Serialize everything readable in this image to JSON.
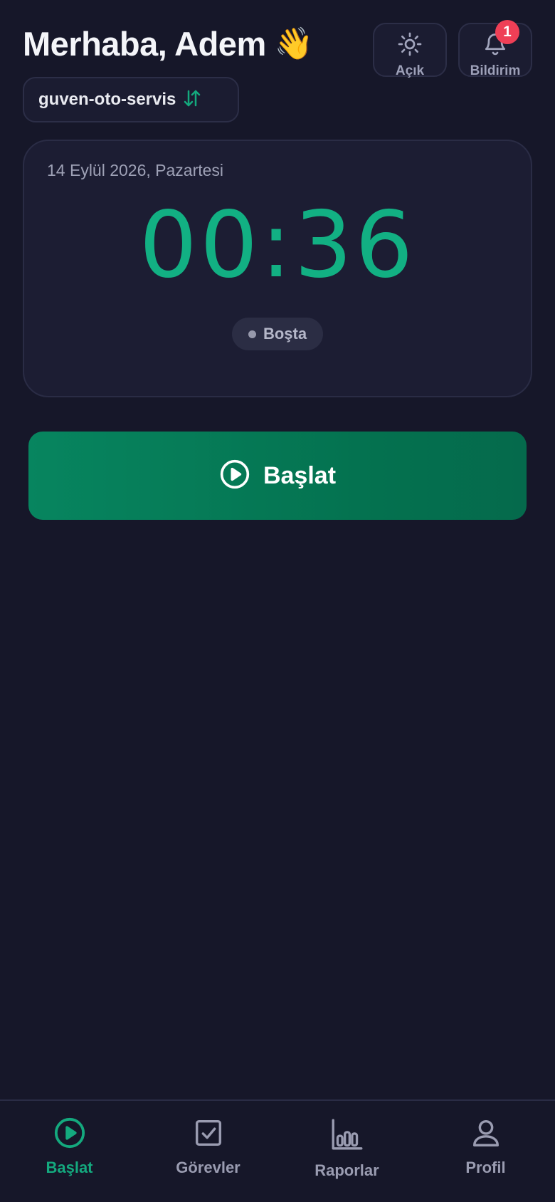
{
  "header": {
    "greeting": "Merhaba, Adem",
    "wave_emoji": "👋",
    "theme_button_label": "Açık",
    "notification_button_label": "Bildirim",
    "notification_count": "1",
    "workspace_name": "guven-oto-servis"
  },
  "timer_card": {
    "date": "14 Eylül 2026, Pazartesi",
    "elapsed": "00:36",
    "status": "Boşta"
  },
  "start_button": {
    "label": "Başlat"
  },
  "bottom_nav": {
    "items": [
      {
        "label": "Başlat",
        "icon": "play-circle-icon",
        "active": true
      },
      {
        "label": "Görevler",
        "icon": "checkbox-icon",
        "active": false
      },
      {
        "label": "Raporlar",
        "icon": "bar-chart-icon",
        "active": false
      },
      {
        "label": "Profil",
        "icon": "user-icon",
        "active": false
      }
    ]
  },
  "colors": {
    "background": "#161729",
    "accent": "#12b083",
    "start_button": "#07855f",
    "badge": "#ef3f56"
  }
}
